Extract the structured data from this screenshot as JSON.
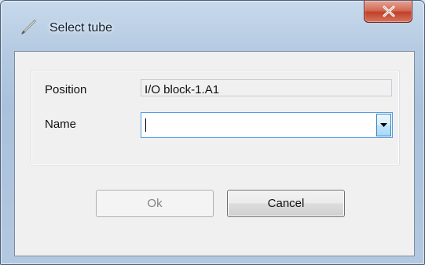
{
  "window": {
    "title": "Select tube",
    "icon": "pencil-icon",
    "close_icon": "close-x-icon"
  },
  "form": {
    "position_label": "Position",
    "position_value": "I/O block-1.A1",
    "name_label": "Name",
    "name_value": "",
    "name_dropdown_icon": "chevron-down-icon"
  },
  "buttons": {
    "ok_label": "Ok",
    "ok_enabled": false,
    "cancel_label": "Cancel"
  },
  "colors": {
    "close_button": "#c2402a",
    "focus_border": "#569de5",
    "disabled_text": "#838383"
  }
}
